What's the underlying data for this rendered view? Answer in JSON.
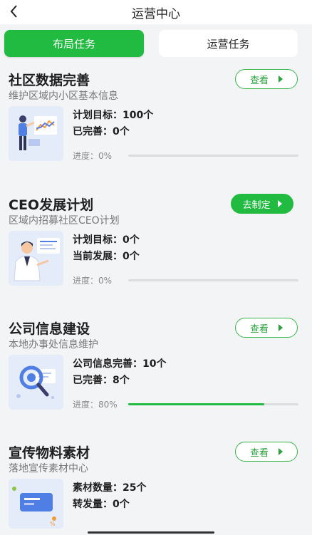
{
  "header": {
    "title": "运营中心"
  },
  "tabs": [
    {
      "label": "布局任务",
      "active": true
    },
    {
      "label": "运营任务",
      "active": false
    }
  ],
  "colors": {
    "accent": "#21bb41",
    "background": "#f3f4f6"
  },
  "sections": [
    {
      "title": "社区数据完善",
      "subtitle": "维护区域内小区基本信息",
      "action": "查看",
      "action_style": "outline",
      "stat1": "计划目标：100个",
      "stat2": "已完善：0个",
      "progress_label": "进度：0%",
      "progress": 0,
      "thumb_icon": "presenter-chart-icon"
    },
    {
      "title": "CEO发展计划",
      "subtitle": "区域内招募社区CEO计划",
      "action": "去制定",
      "action_style": "filled",
      "stat1": "计划目标：0个",
      "stat2": "当前发展：0个",
      "progress_label": "进度：0%",
      "progress": 0,
      "thumb_icon": "businessman-icon"
    },
    {
      "title": "公司信息建设",
      "subtitle": "本地办事处信息维护",
      "action": "查看",
      "action_style": "outline",
      "stat1": "公司信息完善：10个",
      "stat2": "已完善：8个",
      "progress_label": "进度：80%",
      "progress": 80,
      "thumb_icon": "magnifier-document-icon"
    },
    {
      "title": "宣传物料素材",
      "subtitle": "落地宣传素材中心",
      "action": "查看",
      "action_style": "outline",
      "stat1": "素材数量：25个",
      "stat2": "转发量：0个",
      "thumb_icon": "promo-card-icon"
    }
  ]
}
